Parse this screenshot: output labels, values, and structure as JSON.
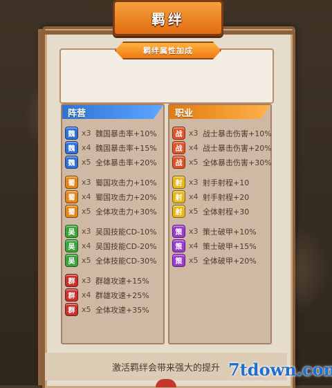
{
  "title": "羁绊",
  "attr_header": "羁绊属性加成",
  "columns": {
    "faction": {
      "header": "阵营",
      "groups": [
        {
          "badge": "魏",
          "color": "#2f6fd6",
          "rows": [
            {
              "mult": "x3",
              "desc": "魏国暴击率+10%"
            },
            {
              "mult": "x4",
              "desc": "魏国暴击率+15%"
            },
            {
              "mult": "x5",
              "desc": "全体暴击率+20%"
            }
          ]
        },
        {
          "badge": "蜀",
          "color": "#e0861a",
          "rows": [
            {
              "mult": "x3",
              "desc": "蜀国攻击力+10%"
            },
            {
              "mult": "x4",
              "desc": "蜀国攻击力+20%"
            },
            {
              "mult": "x5",
              "desc": "全体攻击力+30%"
            }
          ]
        },
        {
          "badge": "吴",
          "color": "#3aa33a",
          "rows": [
            {
              "mult": "x3",
              "desc": "吴国技能CD-10%"
            },
            {
              "mult": "x4",
              "desc": "吴国技能CD-20%"
            },
            {
              "mult": "x5",
              "desc": "全体技能CD-30%"
            }
          ]
        },
        {
          "badge": "群",
          "color": "#c9302c",
          "rows": [
            {
              "mult": "x3",
              "desc": "群雄攻速+15%"
            },
            {
              "mult": "x4",
              "desc": "群雄攻速+25%"
            },
            {
              "mult": "x5",
              "desc": "全体攻速+35%"
            }
          ]
        }
      ]
    },
    "class": {
      "header": "职业",
      "groups": [
        {
          "badge": "战",
          "color": "#e0542a",
          "rows": [
            {
              "mult": "x3",
              "desc": "战士暴击伤害+10%"
            },
            {
              "mult": "x4",
              "desc": "战士暴击伤害+20%"
            },
            {
              "mult": "x5",
              "desc": "全体暴击伤害+30%"
            }
          ]
        },
        {
          "badge": "射",
          "color": "#e6b81e",
          "rows": [
            {
              "mult": "x3",
              "desc": "射手射程+10"
            },
            {
              "mult": "x4",
              "desc": "射手射程+20"
            },
            {
              "mult": "x5",
              "desc": "全体射程+30"
            }
          ]
        },
        {
          "badge": "策",
          "color": "#9b3bd0",
          "rows": [
            {
              "mult": "x3",
              "desc": "策士破甲+10%"
            },
            {
              "mult": "x4",
              "desc": "策士破甲+15%"
            },
            {
              "mult": "x5",
              "desc": "全体破甲+20%"
            }
          ]
        }
      ]
    }
  },
  "footer_text": "激活羁绊会带来强大的提升",
  "watermark": "7tdown.com"
}
